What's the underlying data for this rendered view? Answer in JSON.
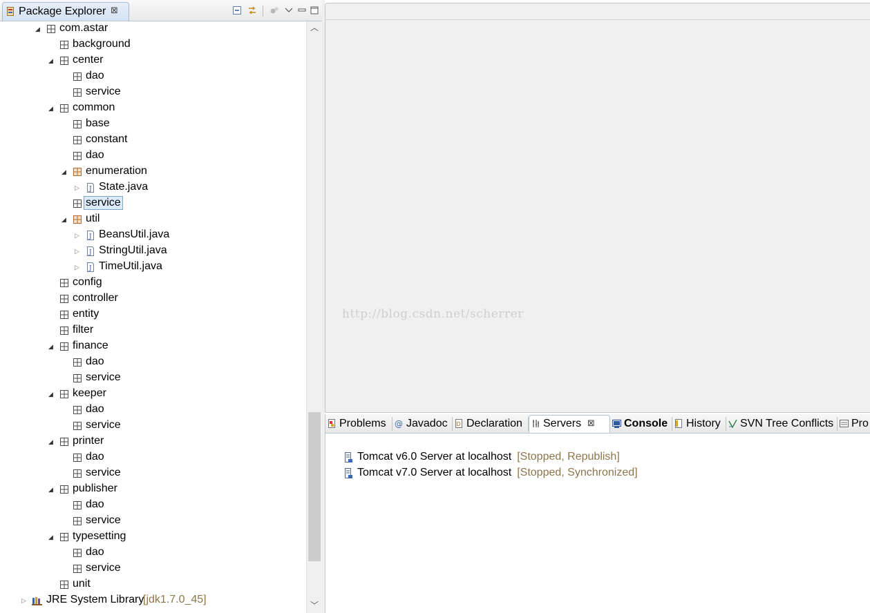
{
  "package_explorer": {
    "title": "Package Explorer",
    "close_glyph": "⊠",
    "tree": [
      {
        "label": "com.astar",
        "depth": 0,
        "expanded": true,
        "icon": "package-icon"
      },
      {
        "label": "background",
        "depth": 1,
        "icon": "package-icon"
      },
      {
        "label": "center",
        "depth": 1,
        "expanded": true,
        "icon": "package-icon"
      },
      {
        "label": "dao",
        "depth": 2,
        "icon": "package-icon"
      },
      {
        "label": "service",
        "depth": 2,
        "icon": "package-icon"
      },
      {
        "label": "common",
        "depth": 1,
        "expanded": true,
        "icon": "package-icon"
      },
      {
        "label": "base",
        "depth": 2,
        "icon": "package-icon"
      },
      {
        "label": "constant",
        "depth": 2,
        "icon": "package-icon"
      },
      {
        "label": "dao",
        "depth": 2,
        "icon": "package-icon"
      },
      {
        "label": "enumeration",
        "depth": 2,
        "expanded": true,
        "icon": "package-icon-colored"
      },
      {
        "label": "State.java",
        "depth": 3,
        "collapsed": true,
        "icon": "java-file-icon"
      },
      {
        "label": "service",
        "depth": 2,
        "selected": true,
        "icon": "package-icon"
      },
      {
        "label": "util",
        "depth": 2,
        "expanded": true,
        "icon": "package-icon-colored"
      },
      {
        "label": "BeansUtil.java",
        "depth": 3,
        "collapsed": true,
        "icon": "java-file-icon"
      },
      {
        "label": "StringUtil.java",
        "depth": 3,
        "collapsed": true,
        "icon": "java-file-icon"
      },
      {
        "label": "TimeUtil.java",
        "depth": 3,
        "collapsed": true,
        "icon": "java-file-icon"
      },
      {
        "label": "config",
        "depth": 1,
        "icon": "package-icon"
      },
      {
        "label": "controller",
        "depth": 1,
        "icon": "package-icon"
      },
      {
        "label": "entity",
        "depth": 1,
        "icon": "package-icon"
      },
      {
        "label": "filter",
        "depth": 1,
        "icon": "package-icon"
      },
      {
        "label": "finance",
        "depth": 1,
        "expanded": true,
        "icon": "package-icon"
      },
      {
        "label": "dao",
        "depth": 2,
        "icon": "package-icon"
      },
      {
        "label": "service",
        "depth": 2,
        "icon": "package-icon"
      },
      {
        "label": "keeper",
        "depth": 1,
        "expanded": true,
        "icon": "package-icon"
      },
      {
        "label": "dao",
        "depth": 2,
        "icon": "package-icon"
      },
      {
        "label": "service",
        "depth": 2,
        "icon": "package-icon"
      },
      {
        "label": "printer",
        "depth": 1,
        "expanded": true,
        "icon": "package-icon"
      },
      {
        "label": "dao",
        "depth": 2,
        "icon": "package-icon"
      },
      {
        "label": "service",
        "depth": 2,
        "icon": "package-icon"
      },
      {
        "label": "publisher",
        "depth": 1,
        "expanded": true,
        "icon": "package-icon"
      },
      {
        "label": "dao",
        "depth": 2,
        "icon": "package-icon"
      },
      {
        "label": "service",
        "depth": 2,
        "icon": "package-icon"
      },
      {
        "label": "typesetting",
        "depth": 1,
        "expanded": true,
        "icon": "package-icon"
      },
      {
        "label": "dao",
        "depth": 2,
        "icon": "package-icon"
      },
      {
        "label": "service",
        "depth": 2,
        "icon": "package-icon"
      },
      {
        "label": "unit",
        "depth": 1,
        "icon": "package-icon"
      },
      {
        "label": "JRE System Library",
        "decoration": "[jdk1.7.0_45]",
        "depth": -1,
        "collapsed": true,
        "icon": "library-icon"
      }
    ]
  },
  "editor": {
    "watermark": "http://blog.csdn.net/scherrer"
  },
  "bottom_views": {
    "tabs": [
      {
        "label": "Problems",
        "icon": "problems-icon"
      },
      {
        "label": "Javadoc",
        "icon": "javadoc-icon"
      },
      {
        "label": "Declaration",
        "icon": "declaration-icon"
      },
      {
        "label": "Servers",
        "icon": "servers-icon",
        "selected": true,
        "close": "⊠"
      },
      {
        "label": "Console",
        "icon": "console-icon",
        "bold": true
      },
      {
        "label": "History",
        "icon": "history-icon"
      },
      {
        "label": "SVN Tree Conflicts",
        "icon": "svn-icon"
      },
      {
        "label": "Pro",
        "icon": "properties-icon"
      }
    ],
    "servers": [
      {
        "name": "Tomcat v6.0 Server at localhost",
        "state": "[Stopped, Republish]"
      },
      {
        "name": "Tomcat v7.0 Server at localhost",
        "state": "[Stopped, Synchronized]"
      }
    ]
  },
  "colors": {
    "selection_bg": "#dcebfc",
    "selection_border": "#7da2ce",
    "decoration_text": "#8c7548",
    "editor_bg": "#f0f0f0"
  }
}
